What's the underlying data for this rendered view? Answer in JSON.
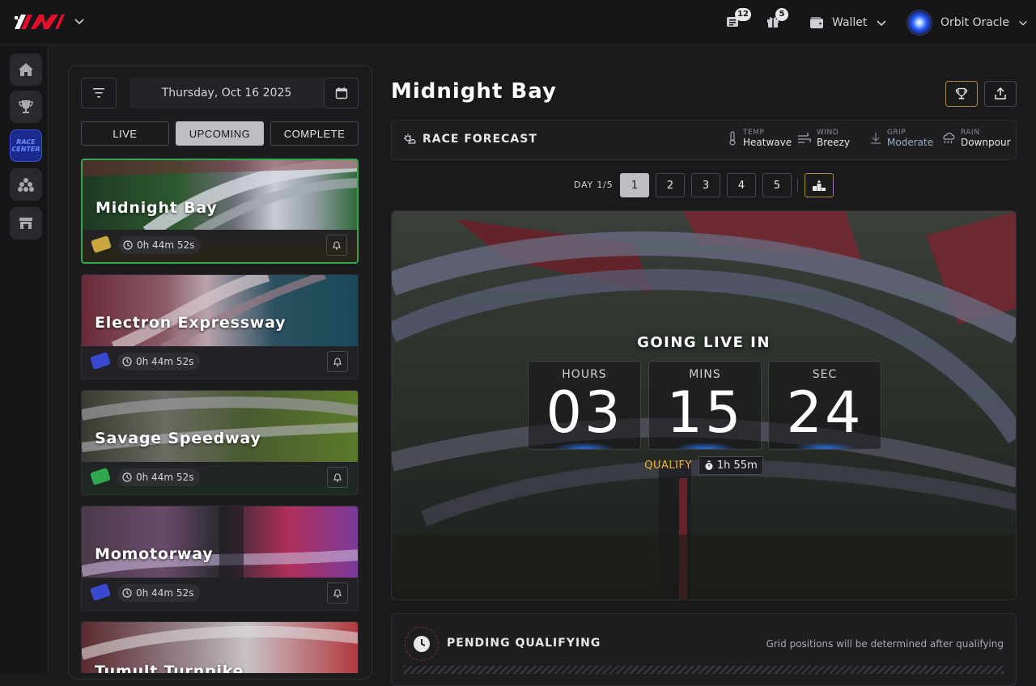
{
  "header": {
    "news_count": "12",
    "gifts_count": "5",
    "wallet_label": "Wallet",
    "user_name": "Orbit Oracle"
  },
  "sidebar": {
    "race_center_label_line1": "RACE",
    "race_center_label_line2": "CENTER"
  },
  "left_panel": {
    "date": "Thursday, Oct 16 2025",
    "tabs": [
      "LIVE",
      "UPCOMING",
      "COMPLETE"
    ],
    "active_tab": "UPCOMING",
    "races": [
      {
        "name": "Midnight Bay",
        "timer": "0h 44m 52s",
        "ticket": "gold",
        "selected": true
      },
      {
        "name": "Electron Expressway",
        "timer": "0h 44m 52s",
        "ticket": "blue",
        "selected": false
      },
      {
        "name": "Savage Speedway",
        "timer": "0h 44m 52s",
        "ticket": "green",
        "selected": false
      },
      {
        "name": "Momotorway",
        "timer": "0h 44m 52s",
        "ticket": "blue",
        "selected": false
      },
      {
        "name": "Tumult Turnpike",
        "timer": "",
        "ticket": "",
        "selected": false
      }
    ]
  },
  "main": {
    "race_title": "Midnight Bay",
    "forecast": {
      "title": "RACE FORECAST",
      "temp_label": "TEMP",
      "temp_value": "Heatwave",
      "wind_label": "WIND",
      "wind_value": "Breezy",
      "grip_label": "GRIP",
      "grip_value": "Moderate",
      "rain_label": "RAIN",
      "rain_value": "Downpour"
    },
    "day_label": "DAY 1/5",
    "days": [
      "1",
      "2",
      "3",
      "4",
      "5"
    ],
    "active_day": "1",
    "countdown": {
      "heading": "GOING LIVE IN",
      "hours_label": "HOURS",
      "hours": "03",
      "mins_label": "MINS",
      "mins": "15",
      "sec_label": "SEC",
      "sec": "24"
    },
    "qualify_label": "QUALIFY",
    "qualify_time": "1h 55m",
    "pending_title": "PENDING QUALIFYING",
    "pending_note": "Grid positions will be determined after qualifying"
  },
  "colors": {
    "accent_green": "#2fa84f",
    "accent_gold": "#f0b429",
    "brand_red": "#e0102a"
  }
}
